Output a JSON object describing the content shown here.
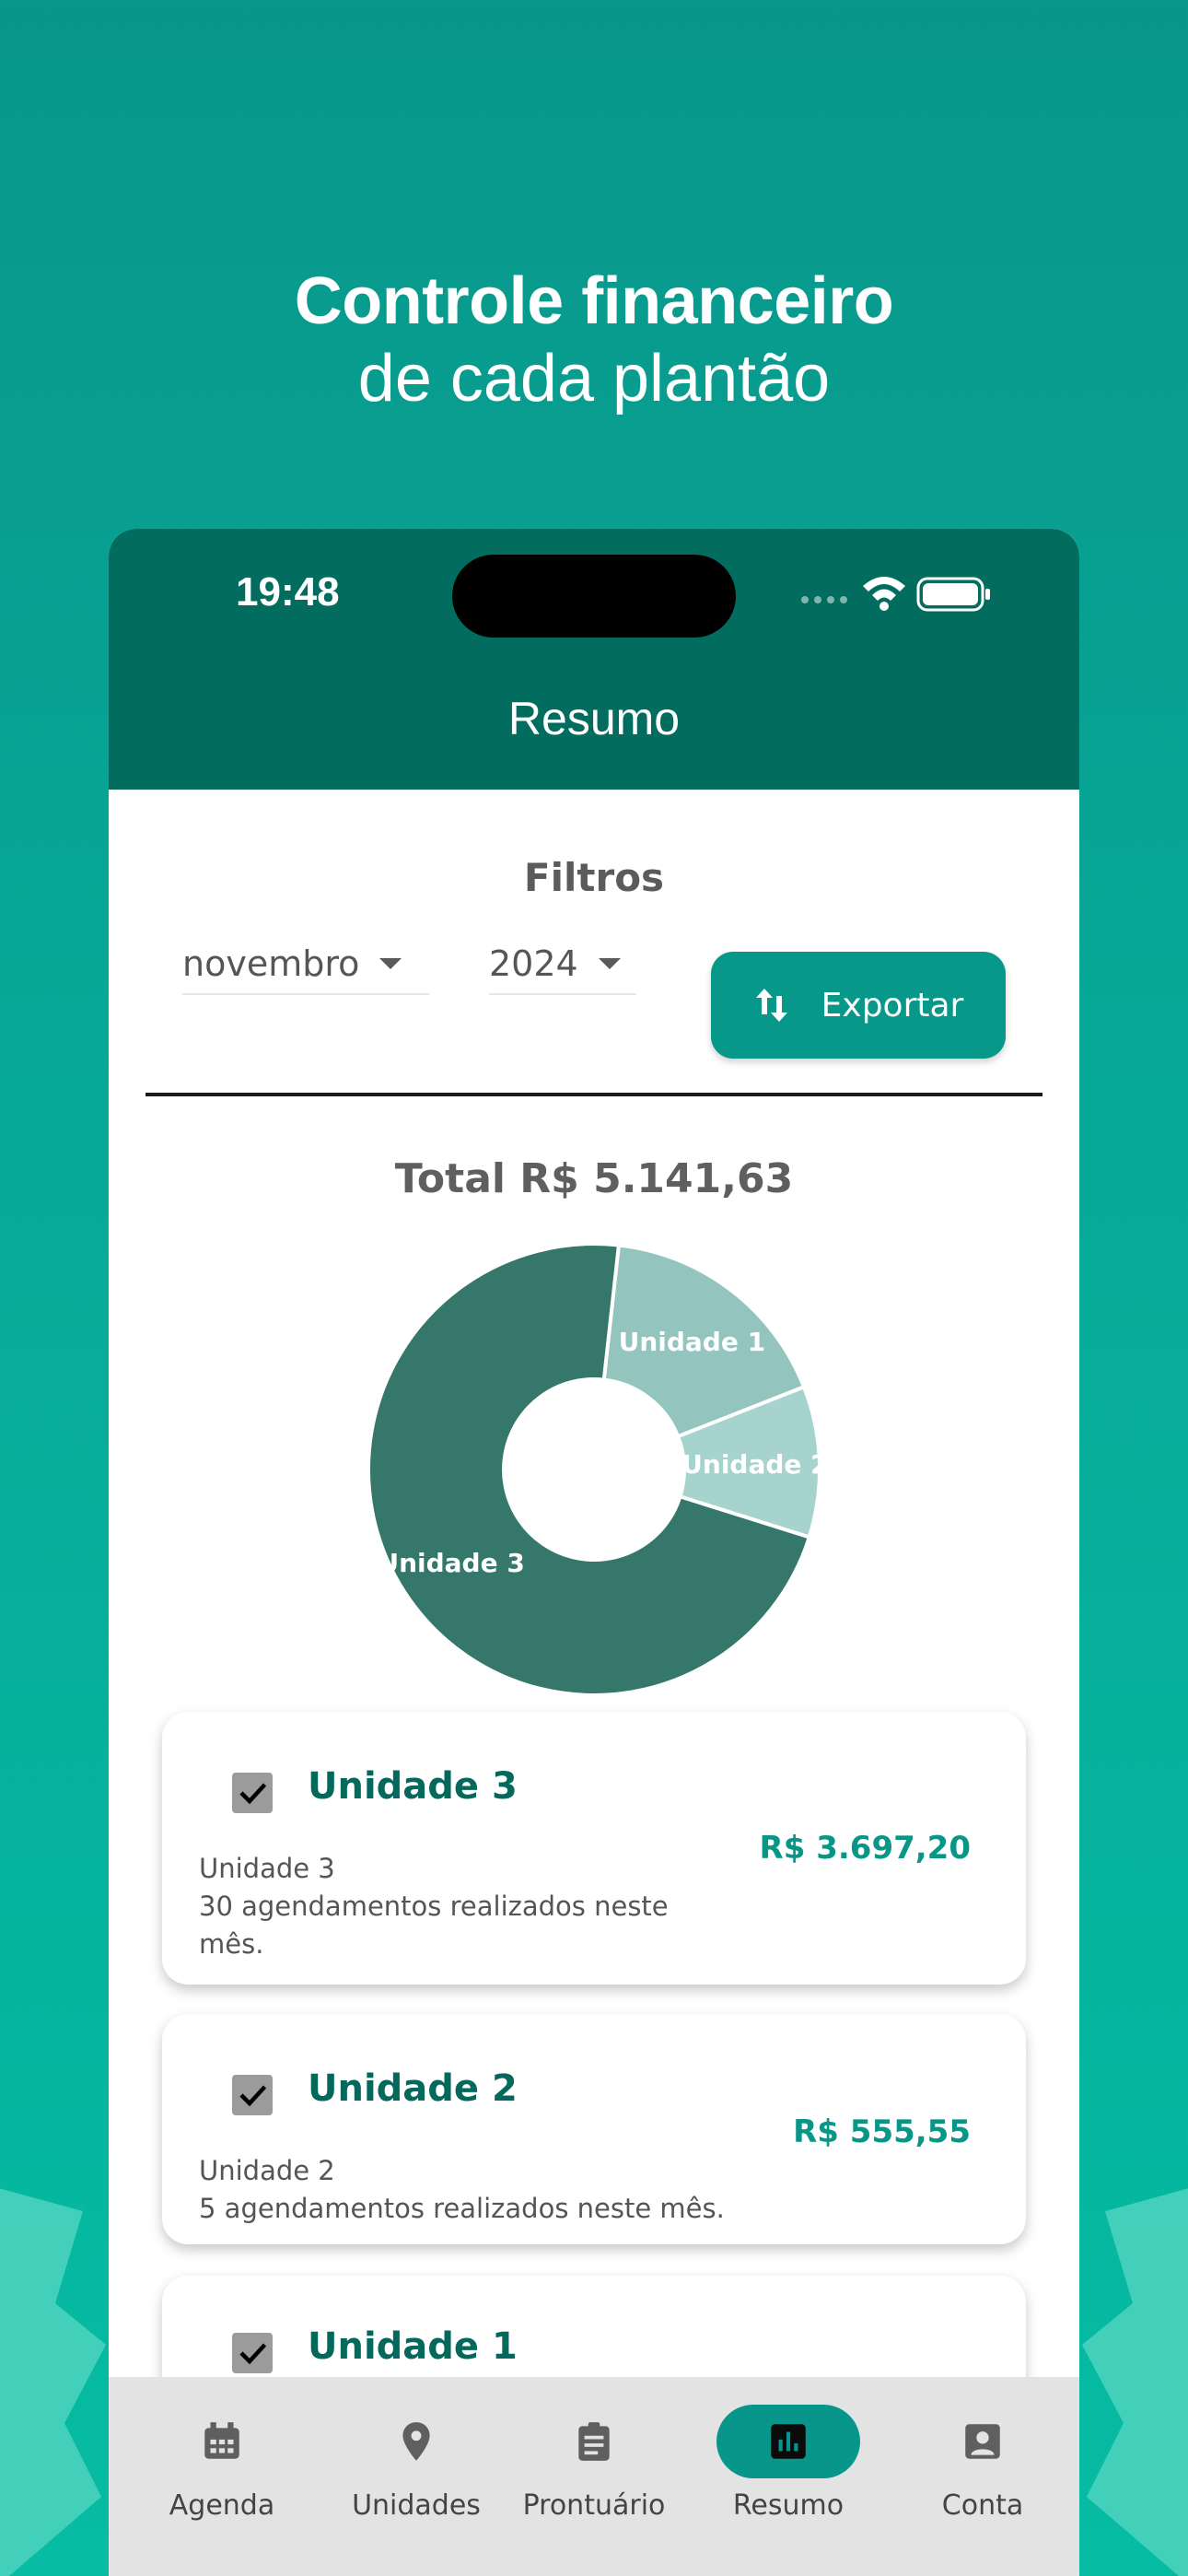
{
  "promo": {
    "headline_line1": "Controle financeiro",
    "headline_line2": "de cada plantão"
  },
  "statusbar": {
    "time": "19:48"
  },
  "appbar": {
    "title": "Resumo"
  },
  "filters": {
    "title": "Filtros",
    "month": "novembro",
    "year": "2024",
    "export_label": "Exportar"
  },
  "summary": {
    "total": "Total R$ 5.141,63"
  },
  "chart_data": {
    "type": "pie",
    "donut": true,
    "categories": [
      "Unidade 1",
      "Unidade 2",
      "Unidade 3"
    ],
    "values": [
      888.88,
      555.55,
      3697.2
    ],
    "colors": [
      "#93c4be",
      "#a6d3cd",
      "#35776b"
    ]
  },
  "units": [
    {
      "name": "Unidade 3",
      "subtitle": "Unidade 3",
      "detail": "30 agendamentos realizados neste mês.",
      "amount": "R$ 3.697,20",
      "checked": true
    },
    {
      "name": "Unidade 2",
      "subtitle": "Unidade 2",
      "detail": "5 agendamentos realizados neste mês.",
      "amount": "R$ 555,55",
      "checked": true
    },
    {
      "name": "Unidade 1",
      "checked": true
    }
  ],
  "nav": {
    "items": [
      {
        "label": "Agenda",
        "icon": "calendar-icon"
      },
      {
        "label": "Unidades",
        "icon": "location-pin-icon"
      },
      {
        "label": "Prontuário",
        "icon": "clipboard-icon"
      },
      {
        "label": "Resumo",
        "icon": "bar-chart-icon",
        "active": true
      },
      {
        "label": "Conta",
        "icon": "account-icon"
      }
    ]
  },
  "colors": {
    "primary_dark": "#026c5f",
    "primary": "#08968a",
    "accent_text": "#04695c"
  }
}
